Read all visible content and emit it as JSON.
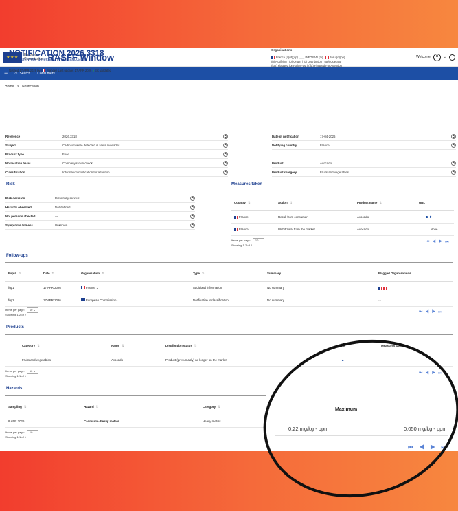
{
  "header": {
    "ec_line1": "European",
    "ec_line2": "Commission",
    "app_title": "RASFF Window",
    "welcome": "Welcome"
  },
  "nav": {
    "search": "Search",
    "consumers": "Consumers"
  },
  "breadcrumb": {
    "home": "Home",
    "sep": ">",
    "current": "Notification"
  },
  "notification": {
    "title": "NOTIFICATION 2026.3318",
    "subtitle": "Cadmium were detected in Hass avocados",
    "notified_prefix": "Notified 17 APR 2026 by",
    "notified_country": "France",
    "last_update": "| Last update: 17 APR 2026",
    "validated": "EC validated"
  },
  "organisations": {
    "title": "Organisations",
    "line1_a": "France (n)(d)(op)",
    "line1_b": "INFOSAN (fu)",
    "line1_c": "Peru (o)(op)",
    "legend1": "(n) Notifying | (o) Origin | (d) Distribution | (op) Operator",
    "legend2": "(fup) Flagged for Follow-Up | (ffa) Flagged For Attention"
  },
  "details_left": [
    {
      "label": "Reference",
      "value": "2026.3318"
    },
    {
      "label": "Subject",
      "value": "Cadmium were detected in Hass avocados"
    },
    {
      "label": "Product type",
      "value": "Food"
    },
    {
      "label": "Notification basis",
      "value": "Company's own check"
    },
    {
      "label": "Classification",
      "value": "Information notification for attention"
    }
  ],
  "details_right_top": [
    {
      "label": "Date of notification",
      "value": "17-04-2026"
    },
    {
      "label": "Notifying country",
      "value": "France"
    }
  ],
  "details_right_bottom": [
    {
      "label": "Product",
      "value": "Avocado"
    },
    {
      "label": "Product category",
      "value": "Fruits and vegetables"
    }
  ],
  "risk": {
    "title": "Risk",
    "rows": [
      {
        "label": "Risk decision",
        "value": "Potentially serious"
      },
      {
        "label": "Hazards observed",
        "value": "Not defined"
      },
      {
        "label": "Nb. persons affected",
        "value": "---"
      },
      {
        "label": "Symptoms / illness",
        "value": "Unknown"
      }
    ]
  },
  "measures": {
    "title": "Measures taken",
    "headers": [
      "Country",
      "Action",
      "Product name",
      "URL"
    ],
    "rows": [
      {
        "country": "France",
        "action": "Recall from consumer",
        "product": "Avocado",
        "url": ""
      },
      {
        "country": "France",
        "action": "Withdrawal from the market",
        "product": "Avocado",
        "url": "None"
      }
    ],
    "items_per_page": "Items per page:",
    "page_size": "10",
    "showing": "Showing 1-2 of 2"
  },
  "followups": {
    "title": "Follow-ups",
    "headers": [
      "Fup #",
      "Date",
      "Organisation",
      "Type",
      "Summary",
      "Flagged Organisations"
    ],
    "rows": [
      {
        "fup": "fup1",
        "date": "17 APR 2026",
        "org": "France",
        "type": "Additional information",
        "summary": "No summary",
        "flagged": ""
      },
      {
        "fup": "fup2",
        "date": "17 APR 2026",
        "org": "European Commission",
        "type": "Notification reclassification",
        "summary": "No summary",
        "flagged": "---"
      }
    ],
    "items_per_page": "Items per page:",
    "page_size": "10",
    "showing": "Showing 1-2 of 2"
  },
  "products": {
    "title": "Products",
    "headers": [
      "Category",
      "Name",
      "Distribution status",
      "Measures taken"
    ],
    "hidden_header": "Ha",
    "rows": [
      {
        "category": "Fruits and vegetables",
        "name": "Avocado",
        "status": "Product (presumably) no longer on the market"
      }
    ],
    "items_per_page": "Items per page:",
    "page_size": "10",
    "showing": "Showing 1-1 of 1"
  },
  "hazards": {
    "title": "Hazards",
    "headers": [
      "Sampling",
      "Hazard",
      "Category"
    ],
    "rows": [
      {
        "sampling": "8 APR 2026",
        "hazard": "Cadmium - heavy metals",
        "category": "Heavy metals"
      }
    ],
    "items_per_page": "Items per page:",
    "page_size": "10",
    "showing": "Showing 1-1 of 1"
  },
  "zoom": {
    "header": "Maximum",
    "value1": "0.22 mg/kg - ppm",
    "value2": "0.050 mg/kg - ppm"
  }
}
